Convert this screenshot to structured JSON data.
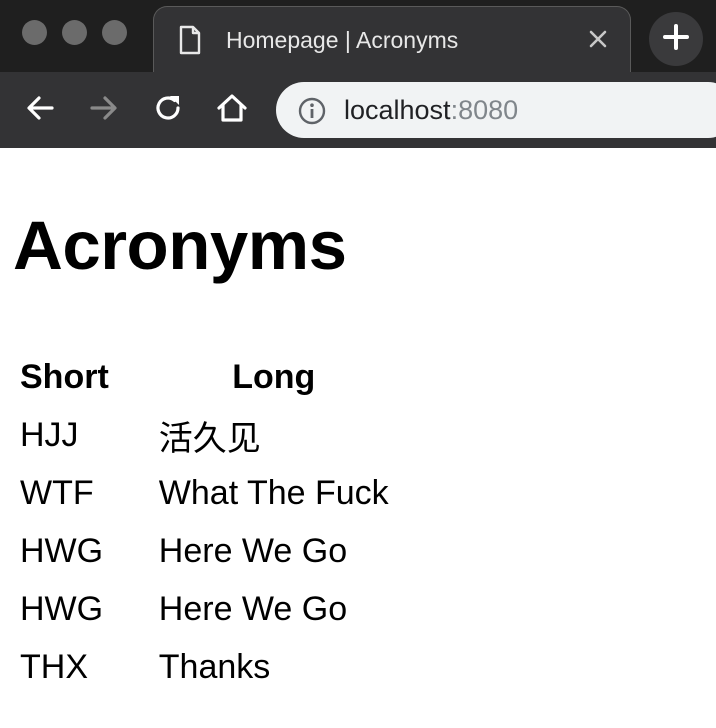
{
  "browser": {
    "tab": {
      "title": "Homepage | Acronyms",
      "page_icon": "page-icon",
      "close_icon": "close-icon"
    },
    "new_tab_icon": "plus-icon",
    "nav": {
      "back_icon": "back-arrow-icon",
      "forward_icon": "forward-arrow-icon",
      "reload_icon": "reload-icon",
      "home_icon": "home-icon"
    },
    "address_bar": {
      "info_icon": "info-icon",
      "host": "localhost",
      "port": ":8080"
    },
    "colors": {
      "chrome_bg": "#1f1f1f",
      "toolbar_bg": "#333335",
      "omnibox_bg": "#f1f3f4"
    }
  },
  "page": {
    "heading": "Acronyms",
    "table": {
      "headers": {
        "short": "Short",
        "long": "Long"
      },
      "rows": [
        {
          "short": "HJJ",
          "long": "活久见"
        },
        {
          "short": "WTF",
          "long": "What The Fuck"
        },
        {
          "short": "HWG",
          "long": "Here We Go"
        },
        {
          "short": "HWG",
          "long": "Here We Go"
        },
        {
          "short": "THX",
          "long": "Thanks"
        }
      ]
    }
  }
}
